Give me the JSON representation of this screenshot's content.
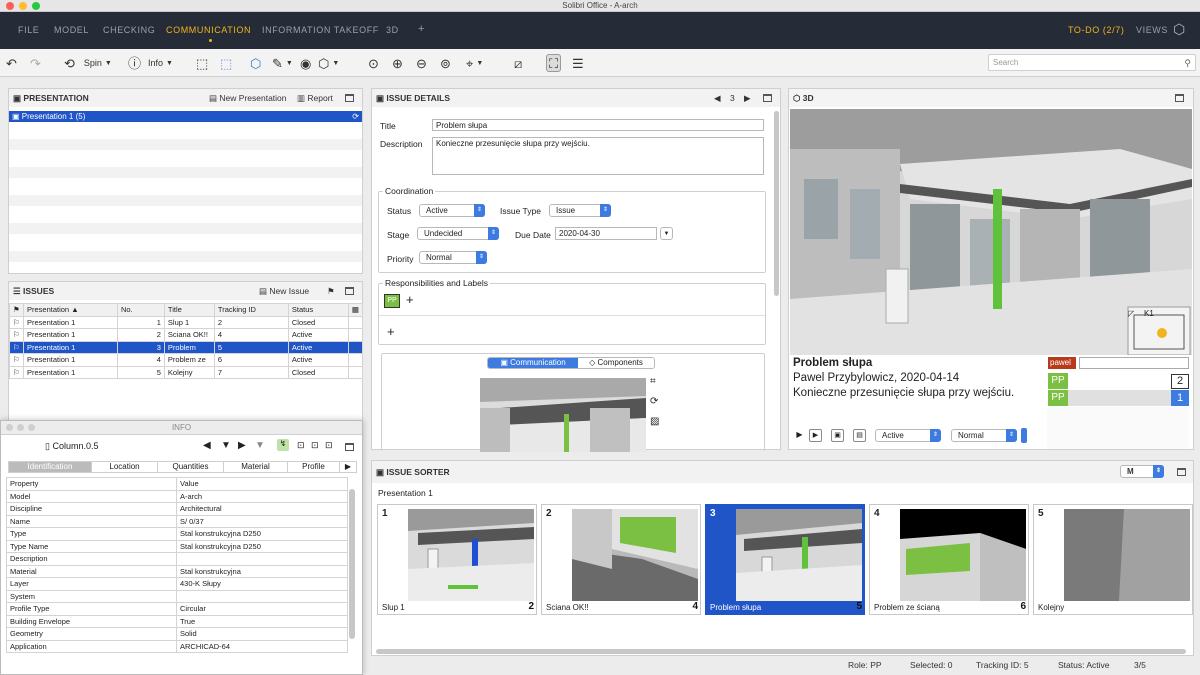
{
  "window": {
    "title": "Solibri Office - A-arch"
  },
  "menu": {
    "items": [
      "FILE",
      "MODEL",
      "CHECKING",
      "COMMUNICATION",
      "INFORMATION TAKEOFF",
      "3D",
      "+"
    ],
    "todo": "TO-DO (2/7)",
    "views": "VIEWS"
  },
  "toolbar": {
    "spin_label": "Spin",
    "info_label": "Info",
    "search_placeholder": "Search"
  },
  "presentation": {
    "title": "PRESENTATION",
    "new_label": "New Presentation",
    "report_label": "Report",
    "items": [
      "Presentation 1 (5)"
    ]
  },
  "issues": {
    "title": "ISSUES",
    "new_label": "New Issue",
    "columns": [
      "Presentation",
      "No.",
      "Title",
      "Tracking ID",
      "Status"
    ],
    "rows": [
      [
        "Presentation 1",
        "1",
        "Slup 1",
        "2",
        "Closed"
      ],
      [
        "Presentation 1",
        "2",
        "Sciana OK!!",
        "4",
        "Active"
      ],
      [
        "Presentation 1",
        "3",
        "Problem",
        "5",
        "Active"
      ],
      [
        "Presentation 1",
        "4",
        "Problem ze",
        "6",
        "Active"
      ],
      [
        "Presentation 1",
        "5",
        "Kolejny",
        "7",
        "Closed"
      ]
    ]
  },
  "info": {
    "window_title": "INFO",
    "object_name": "Column.0.5",
    "tabs": [
      "Identification",
      "Location",
      "Quantities",
      "Material",
      "Profile"
    ],
    "columns": [
      "Property",
      "Value"
    ],
    "rows": [
      [
        "Model",
        "A-arch"
      ],
      [
        "Discipline",
        "Architectural"
      ],
      [
        "Name",
        "S/ 0/37"
      ],
      [
        "Type",
        "Stal konstrukcyjna D250"
      ],
      [
        "Type Name",
        "Stal konstrukcyjna D250"
      ],
      [
        "Description",
        ""
      ],
      [
        "Material",
        "Stal konstrukcyjna"
      ],
      [
        "Layer",
        "430-K Słupy"
      ],
      [
        "System",
        ""
      ],
      [
        "Profile Type",
        "Circular"
      ],
      [
        "Building Envelope",
        "True"
      ],
      [
        "Geometry",
        "Solid"
      ],
      [
        "Application",
        "ARCHICAD-64"
      ]
    ]
  },
  "details": {
    "title": "ISSUE DETAILS",
    "issue_number": "3",
    "title_label": "Title",
    "title_value": "Problem słupa",
    "description_label": "Description",
    "description_value": "Konieczne przesunięcie słupa przy wejściu.",
    "coordination_label": "Coordination",
    "status_label": "Status",
    "status_value": "Active",
    "issue_type_label": "Issue Type",
    "issue_type_value": "Issue",
    "stage_label": "Stage",
    "stage_value": "Undecided",
    "due_label": "Due Date",
    "due_value": "2020-04-30",
    "priority_label": "Priority",
    "priority_value": "Normal",
    "resp_label": "Responsibilities and Labels",
    "resp_badge": "PP",
    "tab_communication": "Communication",
    "tab_components": "Components"
  },
  "view3d": {
    "title": "3D",
    "minimap_label": "K1",
    "issue_title": "Problem słupa",
    "issue_author": "Pawel Przybylowicz, 2020-04-14",
    "issue_desc": "Konieczne przesunięcie słupa przy wejściu.",
    "user_tag": "pawel",
    "resp_rows": [
      {
        "badge": "PP",
        "count": "2"
      },
      {
        "badge": "PP",
        "count": "1"
      }
    ],
    "status_value": "Active",
    "priority_value": "Normal"
  },
  "sorter": {
    "title": "ISSUE SORTER",
    "size_value": "M",
    "presentation_label": "Presentation 1",
    "cards": [
      {
        "num": "1",
        "caption": "Slup 1",
        "count": "2"
      },
      {
        "num": "2",
        "caption": "Sciana OK!!",
        "count": "4"
      },
      {
        "num": "3",
        "caption": "Problem słupa",
        "count": "5"
      },
      {
        "num": "4",
        "caption": "Problem ze ścianą",
        "count": "6"
      },
      {
        "num": "5",
        "caption": "Kolejny",
        "count": ""
      }
    ]
  },
  "statusbar": {
    "role": "Role: PP",
    "selected": "Selected: 0",
    "tracking": "Tracking ID: 5",
    "status": "Status: Active",
    "page": "3/5"
  },
  "colors": {
    "accent": "#f0b41c",
    "selection": "#2055c7",
    "badge_green": "#7cc043",
    "menubar": "#262b38"
  }
}
